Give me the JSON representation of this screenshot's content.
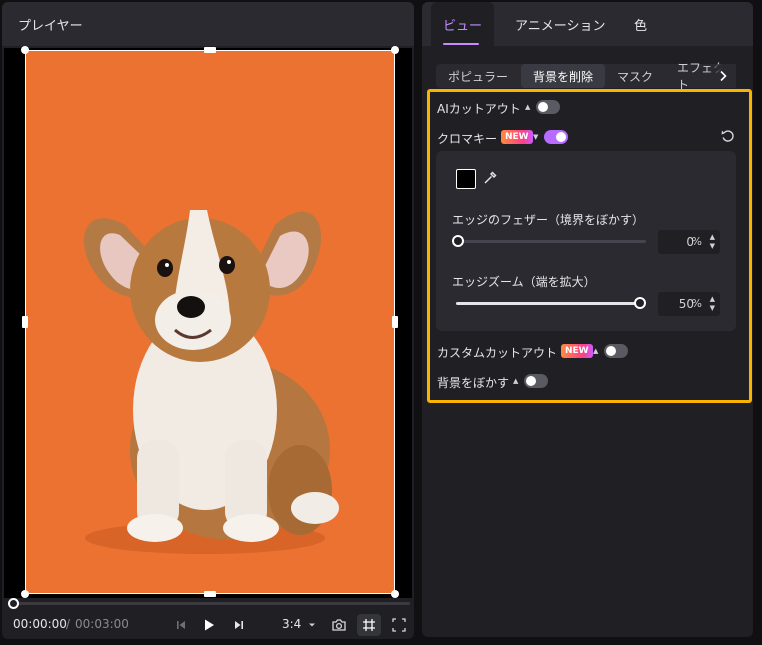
{
  "player": {
    "title": "プレイヤー",
    "time_current": "00:00:00",
    "time_separator": "/",
    "time_total": "00:03:00",
    "aspect_ratio": "3:4",
    "background_color": "#eb7230",
    "icons": {
      "prev": "skip-back-icon",
      "play": "play-icon",
      "next": "skip-forward-icon",
      "ratio_dropdown": "chevron-down-icon",
      "snapshot": "camera-icon",
      "crop": "crop-icon",
      "fullscreen": "fullscreen-icon"
    }
  },
  "panel": {
    "tabs": [
      {
        "label": "ビュー",
        "active": true
      },
      {
        "label": "アニメーション",
        "active": false
      },
      {
        "label": "色",
        "active": false
      }
    ],
    "subtabs": [
      {
        "label": "ポピュラー",
        "active": false
      },
      {
        "label": "背景を削除",
        "active": true
      },
      {
        "label": "マスク",
        "active": false
      },
      {
        "label": "エフェクト",
        "active": false
      }
    ],
    "ai_cutout": {
      "label": "AIカットアウト",
      "enabled": false
    },
    "chroma_key": {
      "label": "クロマキー",
      "badge": "NEW",
      "enabled": true,
      "key_color": "#000000",
      "feather": {
        "label": "エッジのフェザー（境界をぼかす）",
        "value": "0",
        "unit": "%"
      },
      "zoom": {
        "label": "エッジズーム（端を拡大）",
        "value": "50",
        "unit": "%"
      }
    },
    "custom_cutout": {
      "label": "カスタムカットアウト",
      "badge": "NEW",
      "enabled": false
    },
    "blur_background": {
      "label": "背景をぼかす",
      "enabled": false
    },
    "accent_color": "#c58cff",
    "highlight_color": "#f7b500"
  }
}
